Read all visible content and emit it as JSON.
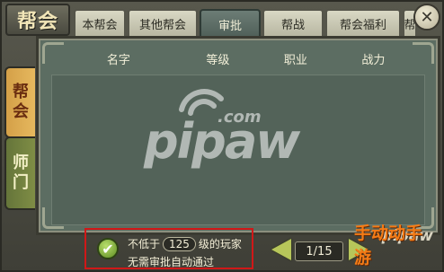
{
  "header": {
    "guild_title": "帮会",
    "tabs": [
      {
        "label": "本帮会"
      },
      {
        "label": "其他帮会"
      },
      {
        "label": "审批"
      },
      {
        "label": "帮战"
      },
      {
        "label": "帮会福利"
      },
      {
        "label": "帮"
      }
    ],
    "active_tab": 2,
    "close_label": "✕"
  },
  "sidebar": {
    "items": [
      {
        "label_top": "帮",
        "label_bottom": "会"
      },
      {
        "label_top": "师",
        "label_bottom": "门"
      }
    ]
  },
  "table": {
    "columns": [
      "名字",
      "等级",
      "职业",
      "战力"
    ],
    "rows": []
  },
  "auto_approve": {
    "checked": true,
    "check_glyph": "✔",
    "prefix": "不低于",
    "level": "125",
    "suffix": "级的玩家",
    "line2": "无需审批自动通过"
  },
  "pagination": {
    "page_label": "1/15"
  },
  "watermark": {
    "main": "pipaw",
    "com": ".com"
  },
  "logo": {
    "top": "pipaw",
    "bottom": "手动动手游"
  },
  "colors": {
    "panel": "#5c6d62",
    "accent_red": "#d01818",
    "arrow": "#b7c65a",
    "guild_tab": "#e6b85e",
    "master_tab": "#7f8d45"
  }
}
